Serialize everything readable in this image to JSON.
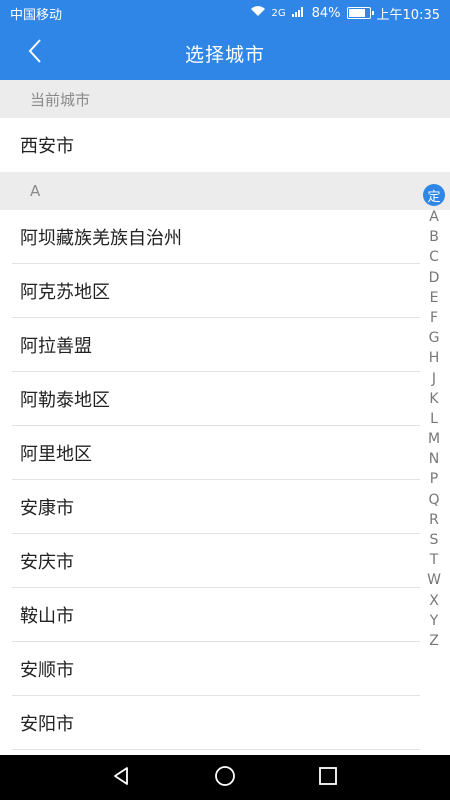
{
  "status_bar": {
    "carrier": "中国移动",
    "network": "2G",
    "battery": "84%",
    "battery_level": 0.84,
    "time": "上午10:35"
  },
  "header": {
    "title": "选择城市",
    "back_icon": "chevron-left-icon"
  },
  "current_city": {
    "section_label": "当前城市",
    "city": "西安市"
  },
  "list_section": {
    "letter": "A",
    "cities": [
      "阿坝藏族羌族自治州",
      "阿克苏地区",
      "阿拉善盟",
      "阿勒泰地区",
      "阿里地区",
      "安康市",
      "安庆市",
      "鞍山市",
      "安顺市",
      "安阳市"
    ]
  },
  "alpha_index": {
    "locate_label": "定",
    "letters": [
      "A",
      "B",
      "C",
      "D",
      "E",
      "F",
      "G",
      "H",
      "J",
      "K",
      "L",
      "M",
      "N",
      "P",
      "Q",
      "R",
      "S",
      "T",
      "W",
      "X",
      "Y",
      "Z"
    ]
  },
  "nav_bar": {
    "icons": [
      "back-triangle-icon",
      "home-circle-icon",
      "recents-square-icon"
    ]
  },
  "colors": {
    "accent": "#2f86e6",
    "section_bg": "#ececec"
  }
}
